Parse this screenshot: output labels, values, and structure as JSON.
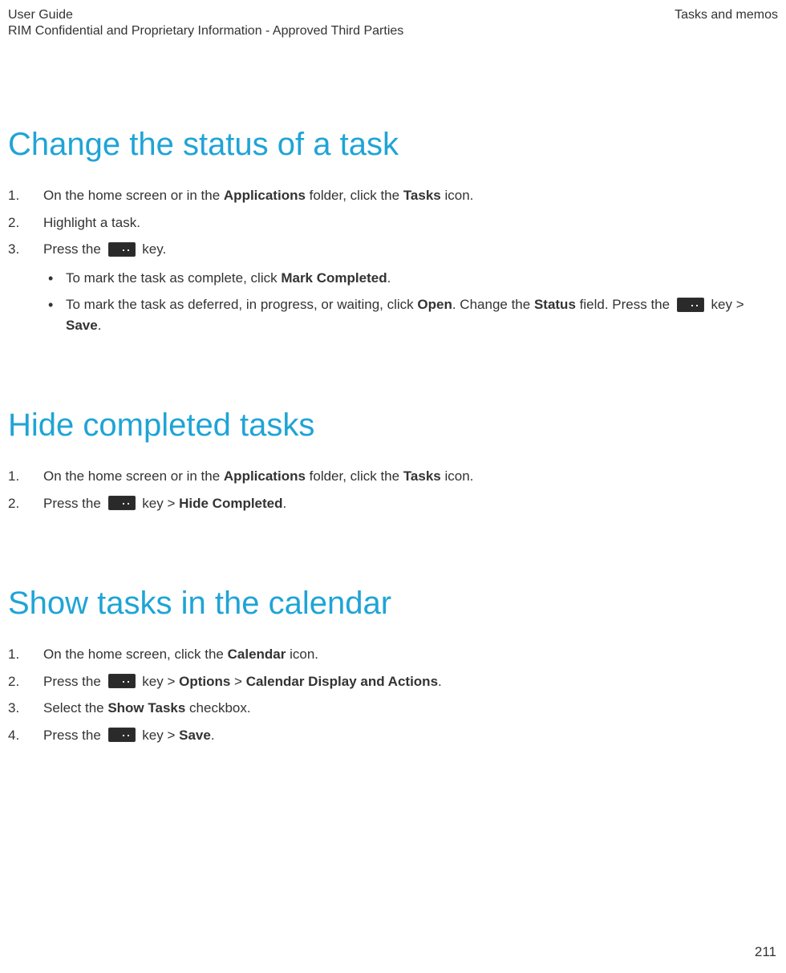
{
  "header": {
    "left1": "User Guide",
    "left2": "RIM Confidential and Proprietary Information - Approved Third Parties",
    "right": "Tasks and memos"
  },
  "page_number": "211",
  "sections": {
    "s1": {
      "title": "Change the status of a task",
      "step1_a": "On the home screen or in the ",
      "step1_b": "Applications",
      "step1_c": " folder, click the ",
      "step1_d": "Tasks",
      "step1_e": " icon.",
      "step2": "Highlight a task.",
      "step3_a": "Press the ",
      "step3_b": " key.",
      "bullet1_a": "To mark the task as complete, click ",
      "bullet1_b": "Mark Completed",
      "bullet1_c": ".",
      "bullet2_a": "To mark the task as deferred, in progress, or waiting, click ",
      "bullet2_b": "Open",
      "bullet2_c": ". Change the ",
      "bullet2_d": "Status",
      "bullet2_e": " field. Press the ",
      "bullet2_f": " key > ",
      "bullet2_g": "Save",
      "bullet2_h": "."
    },
    "s2": {
      "title": "Hide completed tasks",
      "step1_a": "On the home screen or in the ",
      "step1_b": "Applications",
      "step1_c": " folder, click the ",
      "step1_d": "Tasks",
      "step1_e": " icon.",
      "step2_a": "Press the ",
      "step2_b": " key > ",
      "step2_c": "Hide Completed",
      "step2_d": "."
    },
    "s3": {
      "title": "Show tasks in the calendar",
      "step1_a": "On the home screen, click the ",
      "step1_b": "Calendar",
      "step1_c": " icon.",
      "step2_a": "Press the ",
      "step2_b": " key > ",
      "step2_c": "Options",
      "step2_d": " > ",
      "step2_e": "Calendar Display and Actions",
      "step2_f": ".",
      "step3_a": "Select the ",
      "step3_b": "Show Tasks",
      "step3_c": " checkbox.",
      "step4_a": "Press the ",
      "step4_b": " key > ",
      "step4_c": "Save",
      "step4_d": "."
    }
  }
}
